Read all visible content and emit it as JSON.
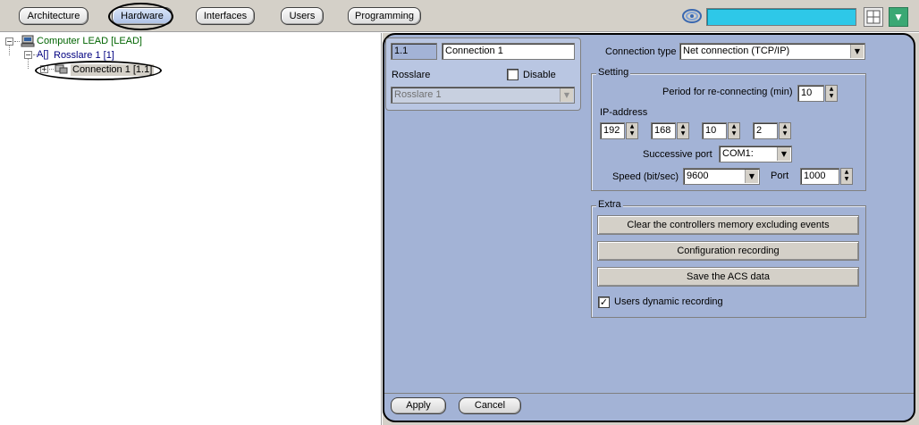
{
  "tabs": [
    {
      "label": "Architecture",
      "active": false
    },
    {
      "label": "Hardware",
      "active": true
    },
    {
      "label": "Interfaces",
      "active": false
    },
    {
      "label": "Users",
      "active": false
    },
    {
      "label": "Programming",
      "active": false
    }
  ],
  "tree": {
    "computer": "Computer LEAD [LEAD]",
    "rosslare_prefix": "A[]",
    "rosslare": "Rosslare 1 [1]",
    "connection": "Connection 1 [1.1]"
  },
  "object": {
    "id": "1.1",
    "name": "Connection 1",
    "parent_label": "Rosslare",
    "disable_label": "Disable",
    "disable_checked": false,
    "parent_value": "Rosslare 1"
  },
  "connection": {
    "type_label": "Connection type",
    "type_value": "Net connection (TCP/IP)"
  },
  "setting": {
    "title": "Setting",
    "period_label": "Period for re-connecting (min)",
    "period_value": "10",
    "ip_label": "IP-address",
    "ip": [
      "192",
      "168",
      "10",
      "2"
    ],
    "port_label": "Successive port",
    "port_value": "COM1:",
    "speed_label": "Speed (bit/sec)",
    "speed_value": "9600",
    "tcp_port_label": "Port",
    "tcp_port_value": "1000"
  },
  "extra": {
    "title": "Extra",
    "clear_btn": "Clear the controllers memory excluding events",
    "config_btn": "Configuration recording",
    "save_btn": "Save the ACS data",
    "dynamic_label": "Users dynamic recording",
    "dynamic_checked": true
  },
  "footer": {
    "apply": "Apply",
    "cancel": "Cancel"
  },
  "colors": {
    "panel_bg": "#a3b3d6",
    "status_display": "#2ec8e8",
    "tree_text_computer": "#006400",
    "tree_text_rosslare": "#000080"
  }
}
